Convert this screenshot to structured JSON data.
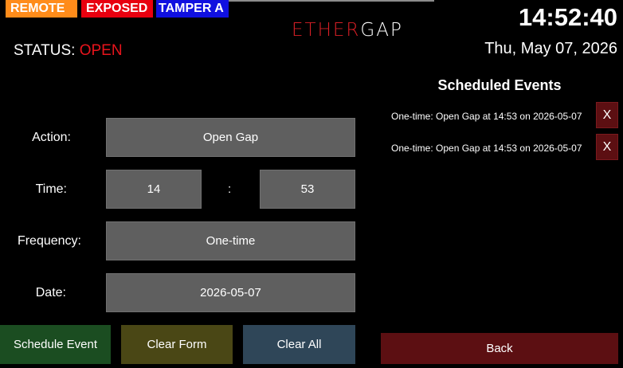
{
  "badges": {
    "remote": "REMOTE",
    "exposed": "EXPOSED",
    "tamper": "TAMPER A"
  },
  "logo": {
    "ether": "ETHER",
    "gap": "GAP"
  },
  "status": {
    "label": "STATUS: ",
    "value": "OPEN"
  },
  "clock": {
    "time": "14:52:40",
    "date": "Thu, May 07, 2026"
  },
  "form": {
    "action_label": "Action:",
    "action_value": "Open Gap",
    "time_label": "Time:",
    "hour_value": "14",
    "separator": ":",
    "minute_value": "53",
    "frequency_label": "Frequency:",
    "frequency_value": "One-time",
    "date_label": "Date:",
    "date_value": "2026-05-07"
  },
  "buttons": {
    "schedule": "Schedule Event",
    "clear_form": "Clear Form",
    "clear_all": "Clear All",
    "back": "Back"
  },
  "events": {
    "title": "Scheduled Events",
    "items": [
      {
        "text": "One-time: Open Gap at 14:53 on 2026-05-07",
        "delete": "X"
      },
      {
        "text": "One-time: Open Gap at 14:53 on 2026-05-07",
        "delete": "X"
      }
    ]
  },
  "colors": {
    "remote": "#ff8c1a",
    "exposed": "#e8000f",
    "tamper": "#1010e0",
    "status_open": "#e8141c",
    "logo_red": "#d81f26"
  }
}
